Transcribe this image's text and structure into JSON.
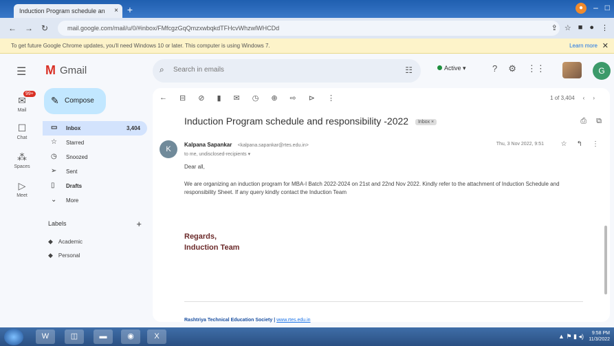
{
  "browser": {
    "tab_title": "Induction Program schedule an",
    "tab_close": "×",
    "new_tab": "+",
    "url": "mail.google.com/mail/u/0/#inbox/FMfcgzGqQmzxwbqkdTFHcvWhzwlWHCDd",
    "infobar_text": "To get future Google Chrome updates, you'll need Windows 10 or later. This computer is using Windows 7.",
    "infobar_link": "Learn more"
  },
  "gmail": {
    "logo_mark": "M",
    "logo_text": "Gmail",
    "search_placeholder": "Search in emails",
    "status": "Active",
    "avatar_letter": "G"
  },
  "rail": {
    "mail_label": "Mail",
    "mail_badge": "99+",
    "chat_label": "Chat",
    "spaces_label": "Spaces",
    "meet_label": "Meet"
  },
  "sidebar": {
    "compose": "Compose",
    "items": [
      {
        "label": "Inbox",
        "count": "3,404"
      },
      {
        "label": "Starred",
        "count": ""
      },
      {
        "label": "Snoozed",
        "count": ""
      },
      {
        "label": "Sent",
        "count": ""
      },
      {
        "label": "Drafts",
        "count": ""
      },
      {
        "label": "More",
        "count": ""
      }
    ],
    "labels_title": "Labels",
    "labels": [
      "Academic",
      "Personal"
    ]
  },
  "email": {
    "pager": "1 of 3,404",
    "subject": "Induction Program schedule and responsibility -2022",
    "tag": "Inbox ×",
    "sender_name": "Kalpana Sapankar",
    "sender_email": "<kalpana.sapankar@rtes.edu.in>",
    "to": "to me, undisclosed-recipients",
    "date": "Thu, 3 Nov 2022, 9:51",
    "avatar_letter": "K",
    "greeting": "Dear all,",
    "body": "We are organizing an induction program for MBA-I Batch 2022-2024 on 21st and 22nd Nov 2022. Kindly refer to the attachment of Induction Schedule and responsibility Sheet. If any query kindly contact the Induction Team",
    "regards": "Regards,",
    "team": "Induction Team",
    "footer": "Rashtriya Technical Education Society",
    "footer_link": "www.rtes.edu.in"
  },
  "taskbar": {
    "tray": "▲ ⚑ ▮ ◂)",
    "time": "9:58 PM",
    "date": "11/3/2022"
  }
}
